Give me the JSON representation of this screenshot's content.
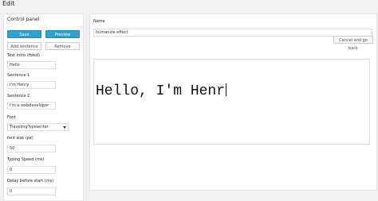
{
  "page": {
    "title": "Edit"
  },
  "control_panel": {
    "title": "Control panel",
    "buttons": {
      "save": "Save",
      "preview": "Preview",
      "add_sentence": "Add sentence",
      "remove": "Remove"
    },
    "fields": {
      "text_intro": {
        "label": "Text intro (fixed)",
        "value": "Hello"
      },
      "sentence1": {
        "label": "Sentence 1",
        "value": "I'm Henry"
      },
      "sentence2": {
        "label": "Sentence 2",
        "value": "I'm a webdeveloper"
      },
      "font": {
        "label": "Font",
        "value": "TravelingTypewriter"
      },
      "font_size": {
        "label": "font size (px)",
        "value": "50"
      },
      "typing_speed": {
        "label": "Typing Speed (ms)",
        "value": "0"
      },
      "delay": {
        "label": "Delay before start (ms)",
        "value": "0"
      }
    }
  },
  "main": {
    "name_label": "Name",
    "name_value": "humanize effect",
    "cancel_button": "Cancel and go back",
    "preview_text": "Hello, I'm Henr"
  }
}
